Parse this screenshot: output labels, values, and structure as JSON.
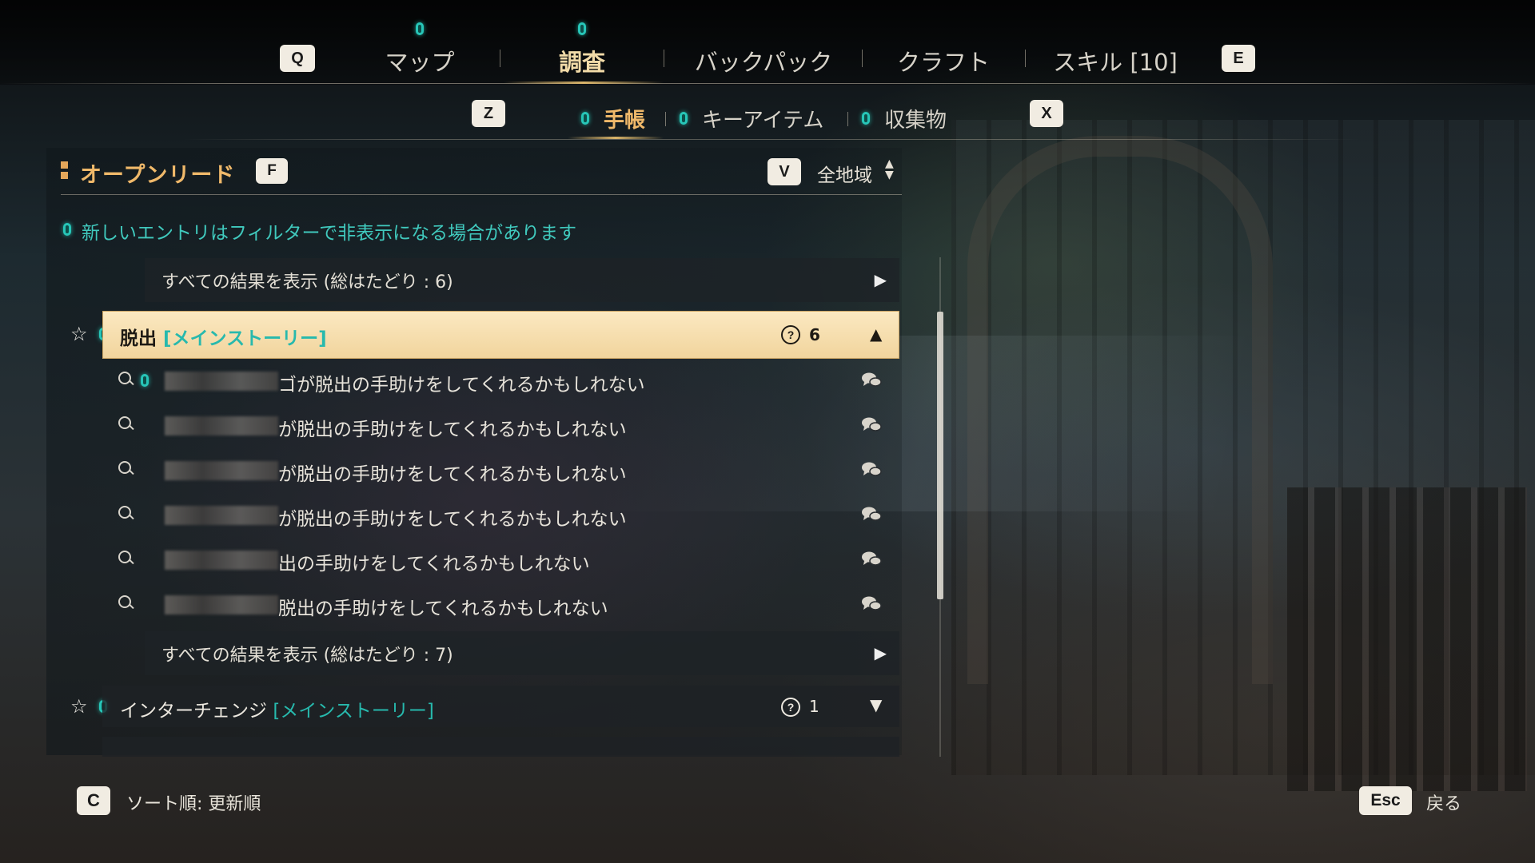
{
  "nav": {
    "prev_key": "Q",
    "next_key": "E",
    "tabs": [
      {
        "label": "マップ",
        "has_new": true
      },
      {
        "label": "調査",
        "has_new": true,
        "active": true
      },
      {
        "label": "バックパック"
      },
      {
        "label": "クラフト"
      },
      {
        "label": "スキル [10]"
      }
    ]
  },
  "subnav": {
    "prev_key": "Z",
    "next_key": "X",
    "tabs": [
      {
        "label": "手帳",
        "active": true
      },
      {
        "label": "キーアイテム"
      },
      {
        "label": "収集物"
      }
    ]
  },
  "section": {
    "title": "オープンリード",
    "key": "F",
    "filter_key": "V",
    "region_filter": "全地域",
    "notice": "新しいエントリはフィルターで非表示になる場合があります"
  },
  "show_all_top": "すべての結果を表示 (総はたどり : 6)",
  "leads": [
    {
      "name": "脱出",
      "tag": "[メインストーリー]",
      "count": "6",
      "expanded": true,
      "entries": [
        {
          "text": "ゴが脱出の手助けをしてくれるかもしれない",
          "new": true
        },
        {
          "text": "が脱出の手助けをしてくれるかもしれない"
        },
        {
          "text": "が脱出の手助けをしてくれるかもしれない"
        },
        {
          "text": "が脱出の手助けをしてくれるかもしれない"
        },
        {
          "text": "出の手助けをしてくれるかもしれない"
        },
        {
          "text": "脱出の手助けをしてくれるかもしれない"
        }
      ],
      "show_all": "すべての結果を表示 (総はたどり : 7)"
    },
    {
      "name": "インターチェンジ",
      "tag": "[メインストーリー]",
      "count": "1",
      "expanded": false
    }
  ],
  "footer": {
    "sort_key": "C",
    "sort_label": "ソート順: 更新順",
    "back_key": "Esc",
    "back_label": "戻る"
  },
  "colors": {
    "accent_gold": "#f0b96a",
    "new_dot": "#27c6b8",
    "tag_teal": "#27b9ad",
    "selected_bg": "#fbe9c2"
  }
}
